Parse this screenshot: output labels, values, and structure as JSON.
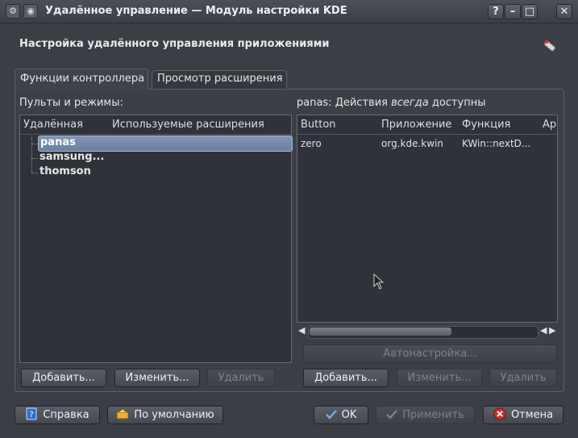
{
  "window": {
    "title": "Удалённое управление — Модуль настройки KDE",
    "help_btn": "?",
    "min_btn": "–",
    "max_btn": "□",
    "close_btn": "✕"
  },
  "heading": "Настройка удалённого управления приложениями",
  "tabs": [
    {
      "label": "Функции контроллера",
      "active": true
    },
    {
      "label": "Просмотр расширения",
      "active": false
    }
  ],
  "left": {
    "label": "Пульты и режимы:",
    "columns": [
      "Удалённая",
      "Используемые расширения"
    ],
    "items": [
      "panas",
      "samsung...",
      "thomson"
    ],
    "selected": "panas",
    "add_label": "Добавить...",
    "edit_label": "Изменить...",
    "remove_label": "Удалить"
  },
  "right": {
    "label_prefix": "panas: Действия ",
    "label_emph": "всегда",
    "label_suffix": " доступны",
    "columns": [
      "Button",
      "Приложение",
      "Функция",
      "Ар"
    ],
    "rows": [
      {
        "button": "zero",
        "app": "org.kde.kwin",
        "func": "KWin::nextD..."
      }
    ],
    "auto_label": "Автонастройка...",
    "add_label": "Добавить...",
    "edit_label": "Изменить...",
    "remove_label": "Удалить"
  },
  "footer": {
    "help_label": "Справка",
    "defaults_label": "По умолчанию",
    "ok_label": "OK",
    "apply_label": "Применить",
    "cancel_label": "Отмена"
  },
  "colors": {
    "background": "#3b3e45",
    "selection": "#7488aa",
    "cancel_icon": "#d0302c",
    "ok_check": "#7fa7e8"
  }
}
